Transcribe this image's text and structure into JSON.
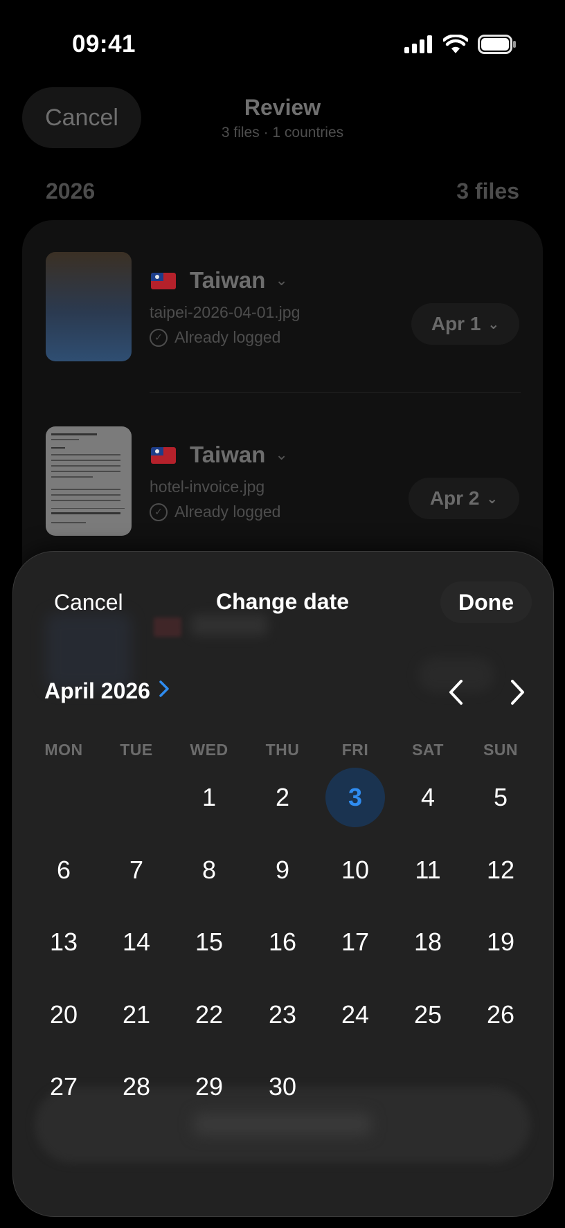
{
  "status_bar": {
    "time": "09:41"
  },
  "background": {
    "cancel_label": "Cancel",
    "title": "Review",
    "subtitle": "3 files · 1 countries",
    "year": "2026",
    "file_count": "3 files",
    "items": [
      {
        "country": "Taiwan",
        "filename": "taipei-2026-04-01.jpg",
        "status": "Already logged",
        "date": "Apr 1"
      },
      {
        "country": "Taiwan",
        "filename": "hotel-invoice.jpg",
        "status": "Already logged",
        "date": "Apr 2"
      }
    ]
  },
  "sheet": {
    "cancel_label": "Cancel",
    "title": "Change date",
    "done_label": "Done",
    "month_label": "April 2026",
    "weekdays": [
      "MON",
      "TUE",
      "WED",
      "THU",
      "FRI",
      "SAT",
      "SUN"
    ],
    "days": [
      "1",
      "2",
      "3",
      "4",
      "5",
      "6",
      "7",
      "8",
      "9",
      "10",
      "11",
      "12",
      "13",
      "14",
      "15",
      "16",
      "17",
      "18",
      "19",
      "20",
      "21",
      "22",
      "23",
      "24",
      "25",
      "26",
      "27",
      "28",
      "29",
      "30"
    ],
    "selected_day": "3",
    "accent_color": "#2f8cf0"
  }
}
